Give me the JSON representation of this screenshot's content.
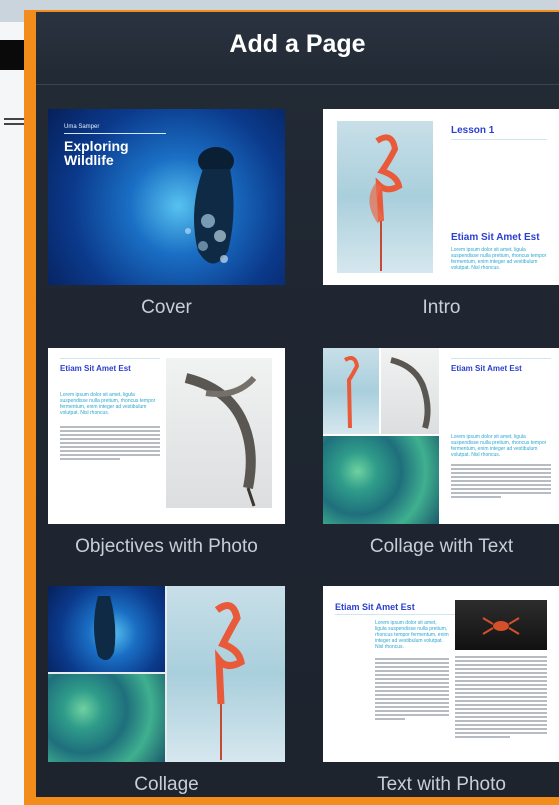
{
  "popover": {
    "title": "Add a Page"
  },
  "templates": [
    {
      "label": "Cover",
      "byline": "Uma Samper",
      "heading": "Exploring Wildlife"
    },
    {
      "label": "Intro",
      "lesson": "Lesson 1",
      "heading": "Etiam Sit Amet Est",
      "body": "Lorem ipsum dolor sit amet, ligula suspendisse nulla pretium, rhoncus tempor fermentum, enim integer ad vestibulum volutpat. Nisl rhoncus."
    },
    {
      "label": "Objectives with Photo",
      "heading": "Etiam Sit Amet Est",
      "body": "Lorem ipsum dolor sit amet, ligula suspendisse nulla pretium, rhoncus tempor fermentum, enim integer ad vestibulum volutpat. Nisl rhoncus."
    },
    {
      "label": "Collage with Text",
      "heading": "Etiam Sit Amet Est",
      "body": "Lorem ipsum dolor sit amet, ligula suspendisse nulla pretium, rhoncus tempor fermentum, enim integer ad vestibulum volutpat. Nisl rhoncus."
    },
    {
      "label": "Collage"
    },
    {
      "label": "Text with Photo",
      "heading": "Etiam Sit Amet Est",
      "body": "Lorem ipsum dolor sit amet, ligula suspendisse nulla pretium, rhoncus tempor fermentum, enim integer ad vestibulum volutpat. Nisl rhoncus."
    }
  ]
}
